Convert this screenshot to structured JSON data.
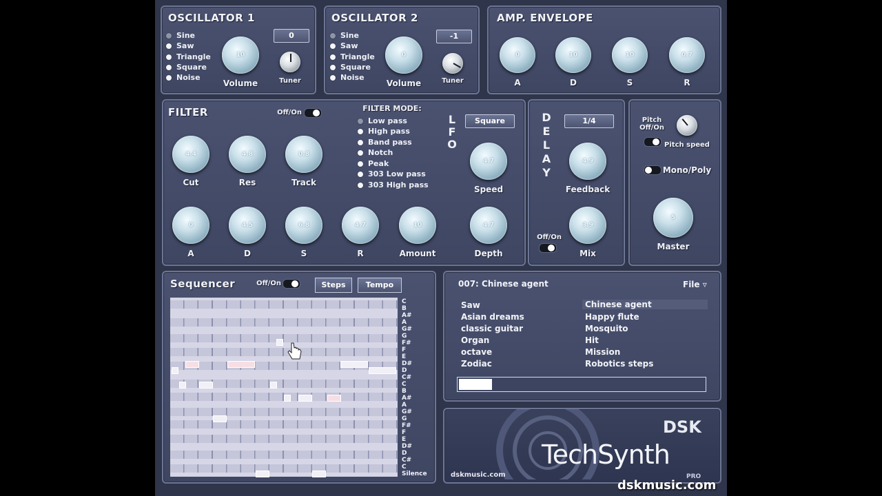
{
  "osc1": {
    "title": "OSCILLATOR 1",
    "waves": [
      "Sine",
      "Saw",
      "Triangle",
      "Square",
      "Noise"
    ],
    "selected_wave": "Sine",
    "octave_value": "0",
    "volume": {
      "label": "Volume",
      "value": "10"
    },
    "tuner_label": "Tuner"
  },
  "osc2": {
    "title": "OSCILLATOR 2",
    "waves": [
      "Sine",
      "Saw",
      "Triangle",
      "Square",
      "Noise"
    ],
    "selected_wave": "Sine",
    "octave_value": "-1",
    "volume": {
      "label": "Volume",
      "value": "0"
    },
    "tuner_label": "Tuner"
  },
  "amp_env": {
    "title": "AMP. ENVELOPE",
    "knobs": [
      {
        "label": "A",
        "value": "0"
      },
      {
        "label": "D",
        "value": "10"
      },
      {
        "label": "S",
        "value": "10"
      },
      {
        "label": "R",
        "value": "0.7"
      }
    ]
  },
  "filter": {
    "title": "FILTER",
    "toggle_label": "Off/On",
    "mode_title": "FILTER MODE:",
    "modes": [
      "Low pass",
      "High pass",
      "Band pass",
      "Notch",
      "Peak",
      "303 Low pass",
      "303 High pass"
    ],
    "selected_mode": "Low pass",
    "top_knobs": [
      {
        "label": "Cut",
        "value": "4.4"
      },
      {
        "label": "Res",
        "value": "4.8"
      },
      {
        "label": "Track",
        "value": "0.8"
      }
    ],
    "bottom_knobs": [
      {
        "label": "A",
        "value": "0"
      },
      {
        "label": "D",
        "value": "4.5"
      },
      {
        "label": "S",
        "value": "6.8"
      },
      {
        "label": "R",
        "value": "4.7"
      },
      {
        "label": "Amount",
        "value": "10"
      }
    ]
  },
  "lfo": {
    "title_letters": [
      "L",
      "F",
      "O"
    ],
    "waveform": "Square",
    "speed": {
      "label": "Speed",
      "value": "4.7"
    },
    "depth": {
      "label": "Depth",
      "value": "4.7"
    }
  },
  "delay": {
    "title_letters": [
      "D",
      "E",
      "L",
      "A",
      "Y"
    ],
    "time_value": "1/4",
    "feedback": {
      "label": "Feedback",
      "value": "4.9"
    },
    "mix": {
      "label": "Mix",
      "value": "3.9"
    },
    "toggle_label": "Off/On"
  },
  "master_section": {
    "pitch_toggle_label_1": "Pitch",
    "pitch_toggle_label_2": "Off/On",
    "pitch_speed_label": "Pitch speed",
    "mono_poly_label": "Mono/Poly",
    "master": {
      "label": "Master",
      "value": "5"
    }
  },
  "sequencer": {
    "title": "Sequencer",
    "toggle_label": "Off/On",
    "steps_button": "Steps",
    "tempo_button": "Tempo",
    "notes": [
      "C",
      "B",
      "A#",
      "A",
      "G#",
      "G",
      "F#",
      "F",
      "E",
      "D#",
      "D",
      "C#",
      "C",
      "B",
      "A#",
      "A",
      "G#",
      "G",
      "F#",
      "F",
      "E",
      "D#",
      "D",
      "C#",
      "C",
      "Silence"
    ]
  },
  "presets": {
    "current": "007: Chinese agent",
    "file_menu": "File ▿",
    "left": [
      "Saw",
      "Asian dreams",
      "classic guitar",
      "Organ",
      "octave",
      "Zodiac"
    ],
    "right": [
      "Chinese agent",
      "Happy flute",
      "Mosquito",
      "Hit",
      "Mission",
      "Robotics steps"
    ],
    "selected": "Chinese agent"
  },
  "branding": {
    "maker": "DSK",
    "product": "TechSynth",
    "edition": "PRO",
    "site_small": "dskmusic.com",
    "site_large": "dskmusic.com"
  },
  "colors": {
    "panel": "#444c6a",
    "background": "#2f354a",
    "knob": "#a9c8d6"
  }
}
